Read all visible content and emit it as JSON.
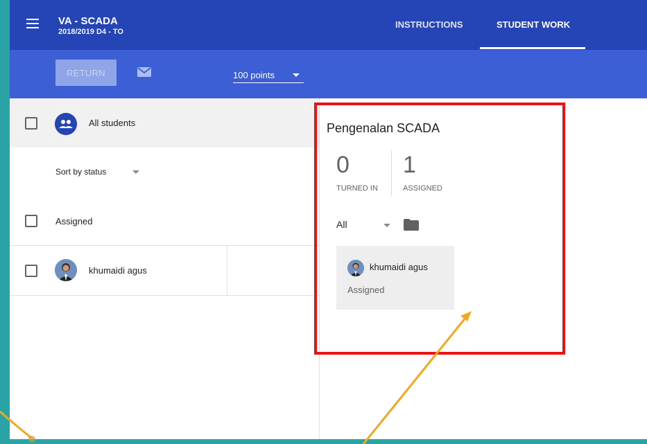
{
  "header": {
    "course_title": "VA - SCADA",
    "course_subtitle": "2018/2019 D4 - TO",
    "tabs": [
      {
        "label": "INSTRUCTIONS"
      },
      {
        "label": "STUDENT WORK",
        "active": true
      }
    ]
  },
  "toolbar": {
    "return_label": "RETURN",
    "points_value": "100 points"
  },
  "left_panel": {
    "all_students_label": "All students",
    "sort_label": "Sort by status",
    "section_label": "Assigned",
    "students": [
      {
        "name": "khumaidi agus"
      }
    ]
  },
  "right_panel": {
    "assignment_title": "Pengenalan SCADA",
    "turned_in_count": "0",
    "turned_in_label": "TURNED IN",
    "assigned_count": "1",
    "assigned_label": "ASSIGNED",
    "filter_value": "All",
    "card": {
      "student_name": "khumaidi agus",
      "status": "Assigned"
    }
  },
  "colors": {
    "header_bg": "#2544b5",
    "toolbar_bg": "#3c5fd6",
    "highlight_box": "#ee1111",
    "arrow": "#f2a81d",
    "page_border": "#2aa3a6"
  }
}
